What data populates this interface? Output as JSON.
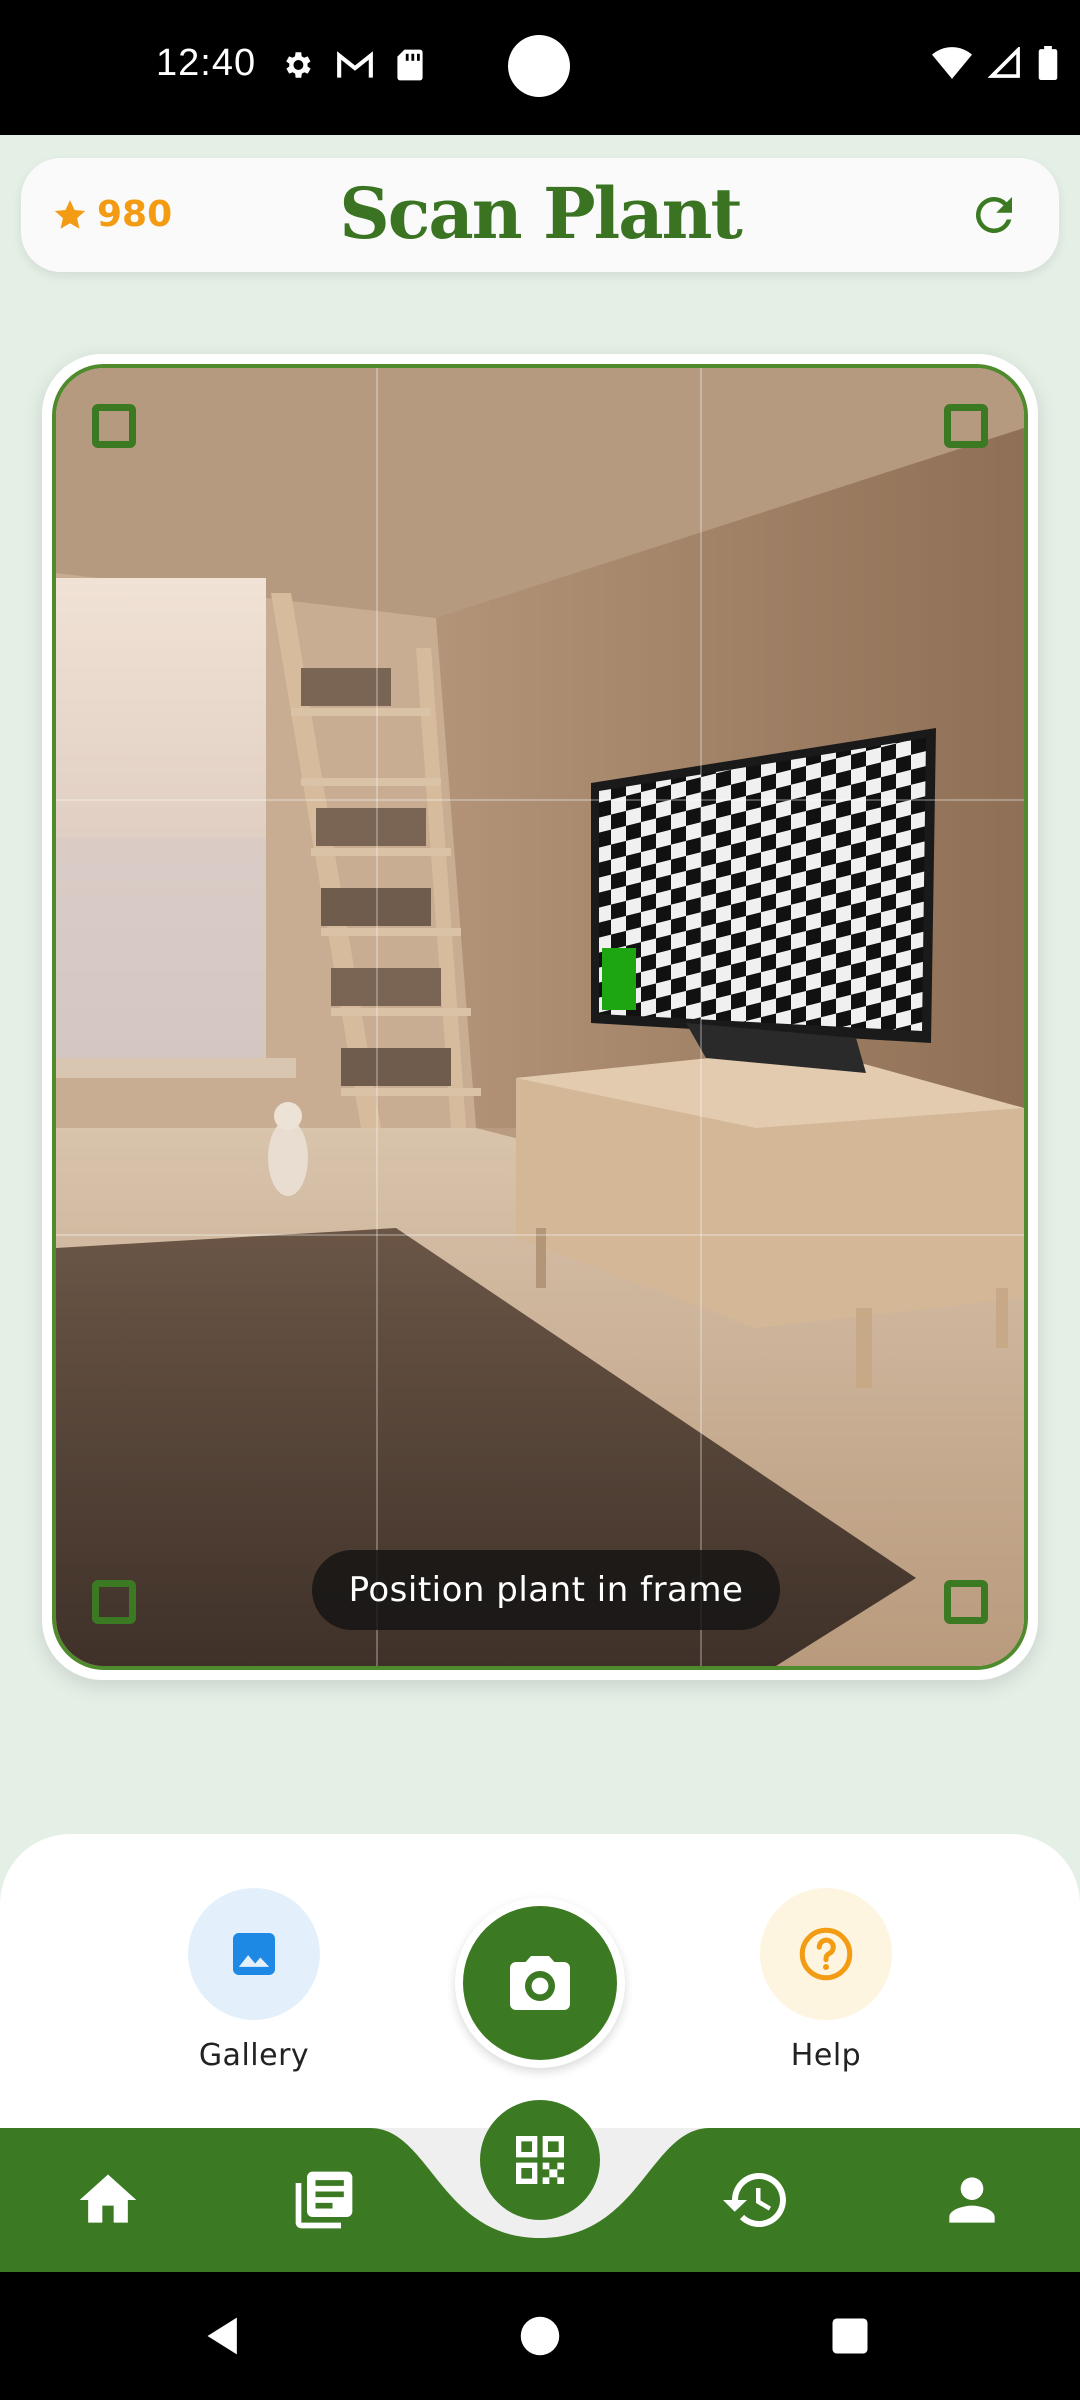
{
  "status_bar": {
    "time": "12:40",
    "left_icons": [
      "gear-icon",
      "gmail-icon",
      "sd-card-icon"
    ],
    "right_icons": [
      "wifi-icon",
      "signal-icon",
      "battery-icon"
    ]
  },
  "header": {
    "points": "980",
    "title": "Scan Plant",
    "points_color": "#f39b12",
    "title_color": "#3a7422"
  },
  "camera": {
    "hint": "Position plant in frame",
    "frame_color": "#3b7a22"
  },
  "actions": {
    "gallery_label": "Gallery",
    "help_label": "Help",
    "gallery_bg": "#e3f0fb",
    "help_bg": "#fdf5e0"
  },
  "bottom_nav": {
    "items": [
      "home-icon",
      "library-icon",
      "scan-qr-icon",
      "history-icon",
      "profile-icon"
    ],
    "active": "scan-qr-icon",
    "color": "#3b7a22"
  },
  "system_nav": [
    "back-icon",
    "home-circle-icon",
    "recents-icon"
  ]
}
